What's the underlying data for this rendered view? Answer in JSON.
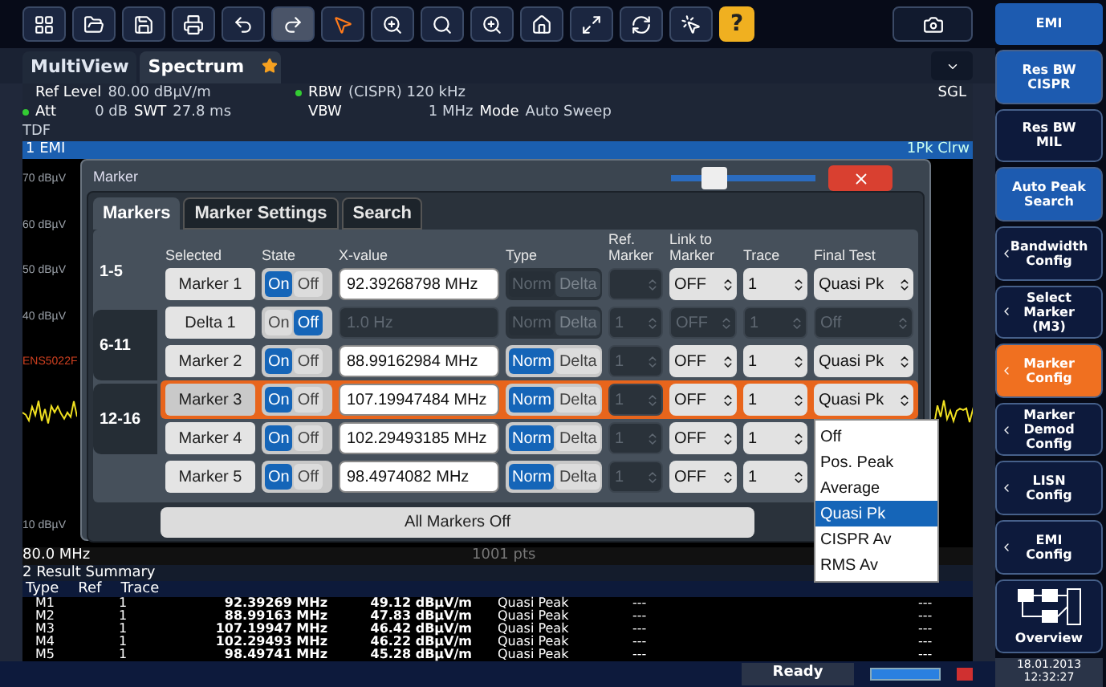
{
  "toolbar": {
    "help_label": "?"
  },
  "tabs": [
    {
      "label": "MultiView",
      "selected": false
    },
    {
      "label": "Spectrum",
      "selected": true
    }
  ],
  "header": {
    "ref_level_label": "Ref Level",
    "ref_level": "80.00 dBµV/m",
    "att_label": "Att",
    "att": "0 dB",
    "swt_label": "SWT",
    "swt": "27.8 ms",
    "rbw_label": "RBW",
    "rbw": "(CISPR) 120 kHz",
    "vbw_label": "VBW",
    "vbw": "1 MHz",
    "mode_label": "Mode",
    "mode": "Auto Sweep",
    "tdf": "TDF",
    "sweep": "SGL"
  },
  "trace_window": {
    "title": "1 EMI",
    "trace_info": "1Pk Clrw",
    "y_labels": [
      "70 dBµV",
      "60 dBµV",
      "50 dBµV",
      "40 dBµV",
      "10 dBµV"
    ],
    "limit_label": "ENS5022F",
    "start": "80.0 MHz",
    "points": "1001 pts"
  },
  "dialog": {
    "title": "Marker",
    "transparency": {
      "level": 0.25
    },
    "tabs": [
      {
        "label": "Markers",
        "selected": true
      },
      {
        "label": "Marker Settings",
        "selected": false
      },
      {
        "label": "Search",
        "selected": false
      }
    ],
    "ranges": [
      {
        "label": "1-5",
        "selected": true
      },
      {
        "label": "6-11",
        "selected": false
      },
      {
        "label": "12-16",
        "selected": false
      }
    ],
    "columns": [
      "Selected",
      "State",
      "X-value",
      "Type",
      "Ref. Marker",
      "Link to Marker",
      "Trace",
      "Final Test"
    ],
    "rows": [
      {
        "name": "Marker 1",
        "selected": false,
        "state": {
          "on_label": "On",
          "off_label": "Off",
          "on": true
        },
        "x_value": {
          "text": "92.39268798 MHz",
          "disabled": false
        },
        "type": {
          "norm_label": "Norm",
          "delta_label": "Delta",
          "norm": false,
          "disabled": true
        },
        "ref_marker": {
          "disabled": true
        },
        "link": {
          "text": "OFF",
          "disabled": false
        },
        "trace": {
          "text": "1",
          "disabled": false
        },
        "final_test": {
          "text": "Quasi Pk",
          "disabled": false
        }
      },
      {
        "name": "Delta 1",
        "selected": false,
        "state": {
          "on_label": "On",
          "off_label": "Off",
          "on": false
        },
        "x_value": {
          "text": "1.0 Hz",
          "disabled": true
        },
        "type": {
          "norm_label": "Norm",
          "delta_label": "Delta",
          "norm": false,
          "disabled": true
        },
        "ref_marker": {
          "text": "1",
          "disabled": true
        },
        "link": {
          "text": "OFF",
          "disabled": true
        },
        "trace": {
          "text": "1",
          "disabled": true
        },
        "final_test": {
          "text": "Off",
          "disabled": true
        }
      },
      {
        "name": "Marker 2",
        "selected": false,
        "state": {
          "on_label": "On",
          "off_label": "Off",
          "on": true
        },
        "x_value": {
          "text": "88.99162984 MHz",
          "disabled": false
        },
        "type": {
          "norm_label": "Norm",
          "delta_label": "Delta",
          "norm": true,
          "disabled": false
        },
        "ref_marker": {
          "text": "1",
          "disabled": true
        },
        "link": {
          "text": "OFF",
          "disabled": false
        },
        "trace": {
          "text": "1",
          "disabled": false
        },
        "final_test": {
          "text": "Quasi Pk",
          "disabled": false
        }
      },
      {
        "name": "Marker 3",
        "selected": true,
        "state": {
          "on_label": "On",
          "off_label": "Off",
          "on": true
        },
        "x_value": {
          "text": "107.19947484 MHz",
          "disabled": false
        },
        "type": {
          "norm_label": "Norm",
          "delta_label": "Delta",
          "norm": true,
          "disabled": false
        },
        "ref_marker": {
          "text": "1",
          "disabled": true
        },
        "link": {
          "text": "OFF",
          "disabled": false
        },
        "trace": {
          "text": "1",
          "disabled": false
        },
        "final_test": {
          "text": "Quasi Pk",
          "disabled": false,
          "menu": [
            {
              "label": "Off",
              "selected": false
            },
            {
              "label": "Pos. Peak",
              "selected": false
            },
            {
              "label": "Average",
              "selected": false
            },
            {
              "label": "Quasi Pk",
              "selected": true
            },
            {
              "label": "CISPR Av",
              "selected": false
            },
            {
              "label": "RMS Av",
              "selected": false
            }
          ]
        }
      },
      {
        "name": "Marker 4",
        "selected": false,
        "state": {
          "on_label": "On",
          "off_label": "Off",
          "on": true
        },
        "x_value": {
          "text": "102.29493185 MHz",
          "disabled": false
        },
        "type": {
          "norm_label": "Norm",
          "delta_label": "Delta",
          "norm": true,
          "disabled": false
        },
        "ref_marker": {
          "text": "1",
          "disabled": true
        },
        "link": {
          "text": "OFF",
          "disabled": false
        },
        "trace": {
          "text": "1",
          "disabled": false
        }
      },
      {
        "name": "Marker 5",
        "selected": false,
        "state": {
          "on_label": "On",
          "off_label": "Off",
          "on": true
        },
        "x_value": {
          "text": "98.4974082 MHz",
          "disabled": false
        },
        "type": {
          "norm_label": "Norm",
          "delta_label": "Delta",
          "norm": true,
          "disabled": false
        },
        "ref_marker": {
          "text": "1",
          "disabled": true
        },
        "link": {
          "text": "OFF",
          "disabled": false
        },
        "trace": {
          "text": "1",
          "disabled": false
        }
      }
    ],
    "all_off_button": "All Markers Off"
  },
  "results": {
    "title": "2 Result Summary",
    "columns": [
      "Type",
      "Ref",
      "Trace"
    ],
    "rows": [
      {
        "type": "M1",
        "trace": "1",
        "x": "92.39269 MHz",
        "y": "49.12 dBµV/m",
        "function": "Quasi Peak",
        "result_1": "---",
        "result_2": "---"
      },
      {
        "type": "M2",
        "trace": "1",
        "x": "88.99163 MHz",
        "y": "47.83 dBµV/m",
        "function": "Quasi Peak",
        "result_1": "---",
        "result_2": "---"
      },
      {
        "type": "M3",
        "trace": "1",
        "x": "107.19947 MHz",
        "y": "46.42 dBµV/m",
        "function": "Quasi Peak",
        "result_1": "---",
        "result_2": "---"
      },
      {
        "type": "M4",
        "trace": "1",
        "x": "102.29493 MHz",
        "y": "46.22 dBµV/m",
        "function": "Quasi Peak",
        "result_1": "---",
        "result_2": "---"
      },
      {
        "type": "M5",
        "trace": "1",
        "x": "98.49741 MHz",
        "y": "45.28 dBµV/m",
        "function": "Quasi Peak",
        "result_1": "---",
        "result_2": "---"
      }
    ]
  },
  "status": {
    "text": "Ready",
    "progress": {
      "level": 1
    },
    "date": "18.01.2013",
    "time": "12:32:27"
  },
  "softkeys": {
    "title": "EMI",
    "items": [
      {
        "lines": [
          "Res BW",
          "CISPR"
        ],
        "kind": "toggle",
        "on": true,
        "selected": false
      },
      {
        "lines": [
          "Res BW",
          "MIL"
        ],
        "kind": "toggle",
        "on": false,
        "selected": false
      },
      {
        "lines": [
          "Auto Peak",
          "Search"
        ],
        "kind": "toggle",
        "on": true,
        "selected": false
      },
      {
        "lines": [
          "Bandwidth",
          "Config"
        ],
        "kind": "submenu",
        "selected": false
      },
      {
        "lines": [
          "Select",
          "Marker",
          "(M3)"
        ],
        "kind": "submenu",
        "selected": false
      },
      {
        "lines": [
          "Marker",
          "Config"
        ],
        "kind": "submenu",
        "selected": true
      },
      {
        "lines": [
          "Marker",
          "Demod",
          "Config"
        ],
        "kind": "submenu",
        "selected": false
      },
      {
        "lines": [
          "LISN",
          "Config"
        ],
        "kind": "submenu",
        "selected": false
      },
      {
        "lines": [
          "EMI",
          "Config"
        ],
        "kind": "submenu",
        "selected": false
      },
      {
        "lines": [
          "Overview"
        ],
        "kind": "overview",
        "selected": false
      }
    ]
  }
}
